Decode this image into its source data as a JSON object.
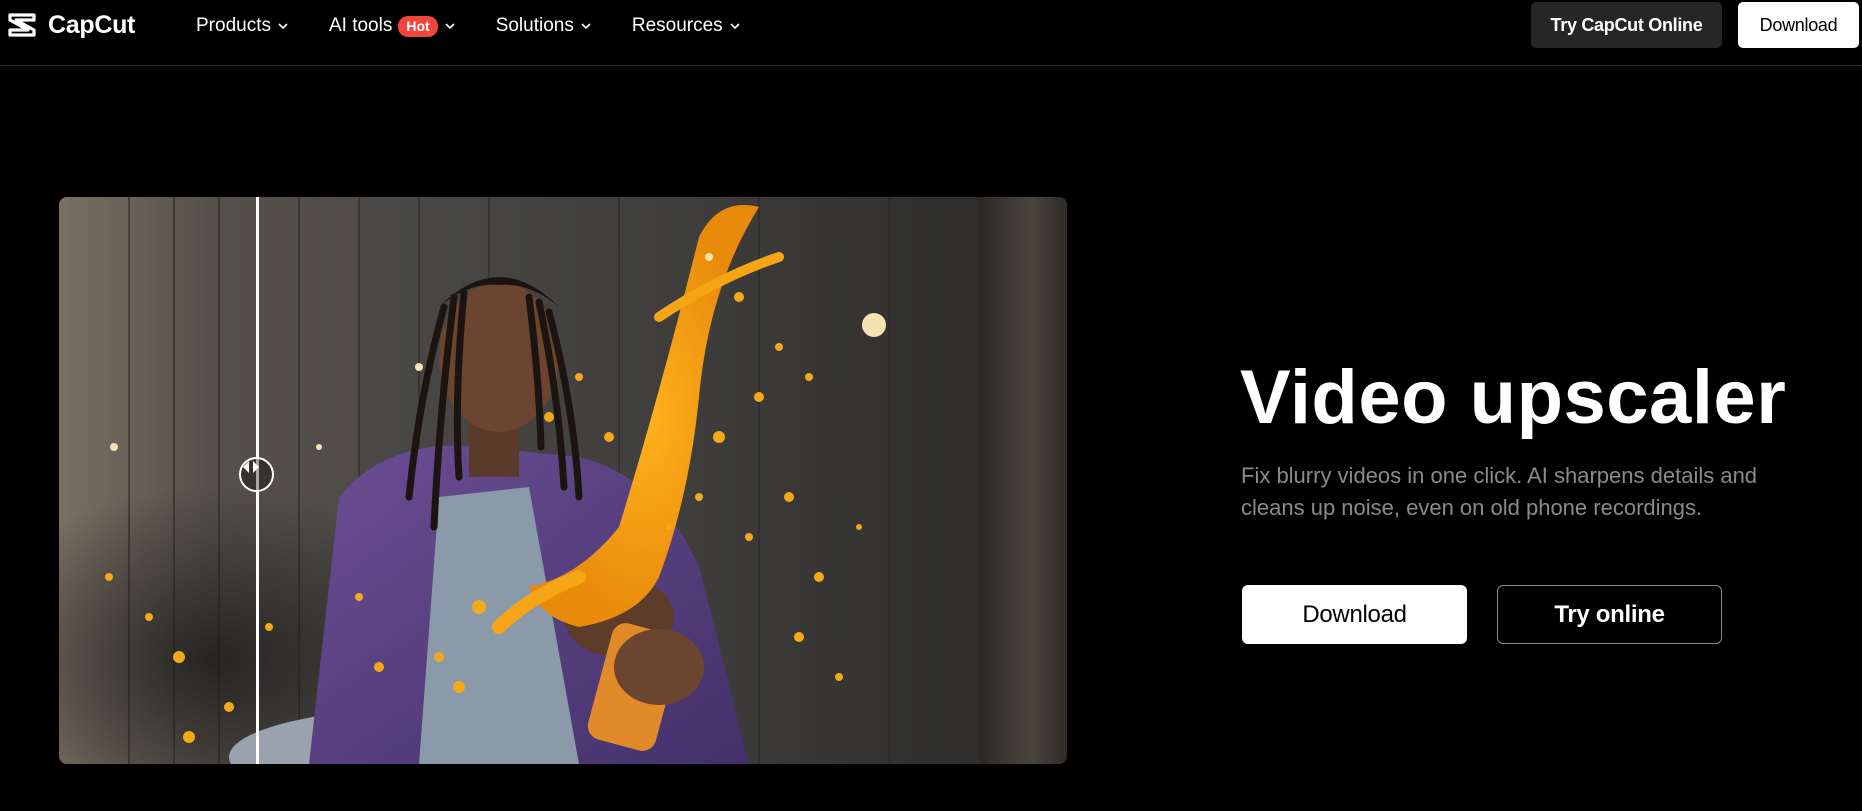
{
  "brand": {
    "name": "CapCut",
    "logo_icon": "capcut-logo-icon"
  },
  "nav": {
    "items": [
      {
        "label": "Products",
        "icon": "chevron-down-icon"
      },
      {
        "label": "AI tools",
        "badge": "Hot",
        "icon": "chevron-down-icon"
      },
      {
        "label": "Solutions",
        "icon": "chevron-down-icon"
      },
      {
        "label": "Resources",
        "icon": "chevron-down-icon"
      }
    ],
    "try_online_label": "Try CapCut Online",
    "download_label": "Download"
  },
  "hero": {
    "title": "Video upscaler",
    "description": "Fix blurry videos in one click. AI sharpens details and cleans up noise, even on old phone recordings.",
    "download_label": "Download",
    "try_online_label": "Try online",
    "comparison_slider_icon": "compare-arrows-icon",
    "comparison_position_fraction": 0.196
  },
  "colors": {
    "background": "#000000",
    "hot_badge": "#f2453d",
    "description_text": "#8a8a8a",
    "secondary_button": "#262626"
  }
}
